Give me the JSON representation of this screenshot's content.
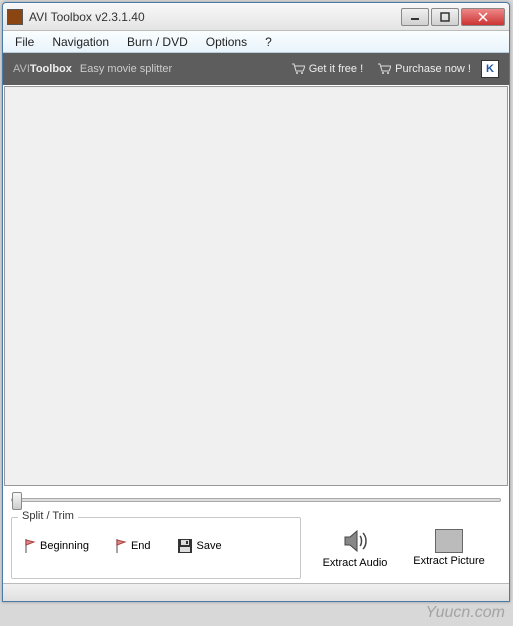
{
  "window": {
    "title": "AVI Toolbox v2.3.1.40"
  },
  "menu": {
    "items": [
      "File",
      "Navigation",
      "Burn / DVD",
      "Options",
      "?"
    ]
  },
  "toolbar": {
    "brand_prefix": "AVI",
    "brand_suffix": "Toolbox",
    "tagline": "Easy movie splitter",
    "get_free": "Get it free !",
    "purchase": "Purchase now !",
    "logo_letter": "K"
  },
  "split": {
    "legend": "Split / Trim",
    "beginning": "Beginning",
    "end": "End",
    "save": "Save"
  },
  "extract": {
    "audio": "Extract Audio",
    "picture": "Extract Picture"
  },
  "watermark": "Yuucn.com"
}
